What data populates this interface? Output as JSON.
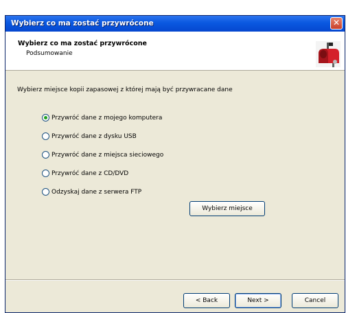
{
  "window": {
    "title": "Wybierz co ma zostać przywrócone",
    "close_glyph": "✕"
  },
  "header": {
    "title": "Wybierz co ma zostać przywrócone",
    "subtitle": "Podsumowanie",
    "icon": "mailbox-icon"
  },
  "main": {
    "prompt": "Wybierz miejsce kopii zapasowej z której mają być przywracane dane",
    "options": [
      {
        "label": "Przywróć dane z mojego komputera",
        "checked": true
      },
      {
        "label": "Przywróć dane z dysku USB",
        "checked": false
      },
      {
        "label": "Przywróć dane z miejsca sieciowego",
        "checked": false
      },
      {
        "label": "Przywróć dane z CD/DVD",
        "checked": false
      },
      {
        "label": "Odzyskaj dane z serwera FTP",
        "checked": false
      }
    ],
    "choose_button": "Wybierz miejsce"
  },
  "footer": {
    "back": "< Back",
    "next": "Next >",
    "cancel": "Cancel"
  },
  "colors": {
    "titlebar": "#0a58e0",
    "dialog_bg": "#ece9d8",
    "mailbox_red": "#d4202a"
  }
}
